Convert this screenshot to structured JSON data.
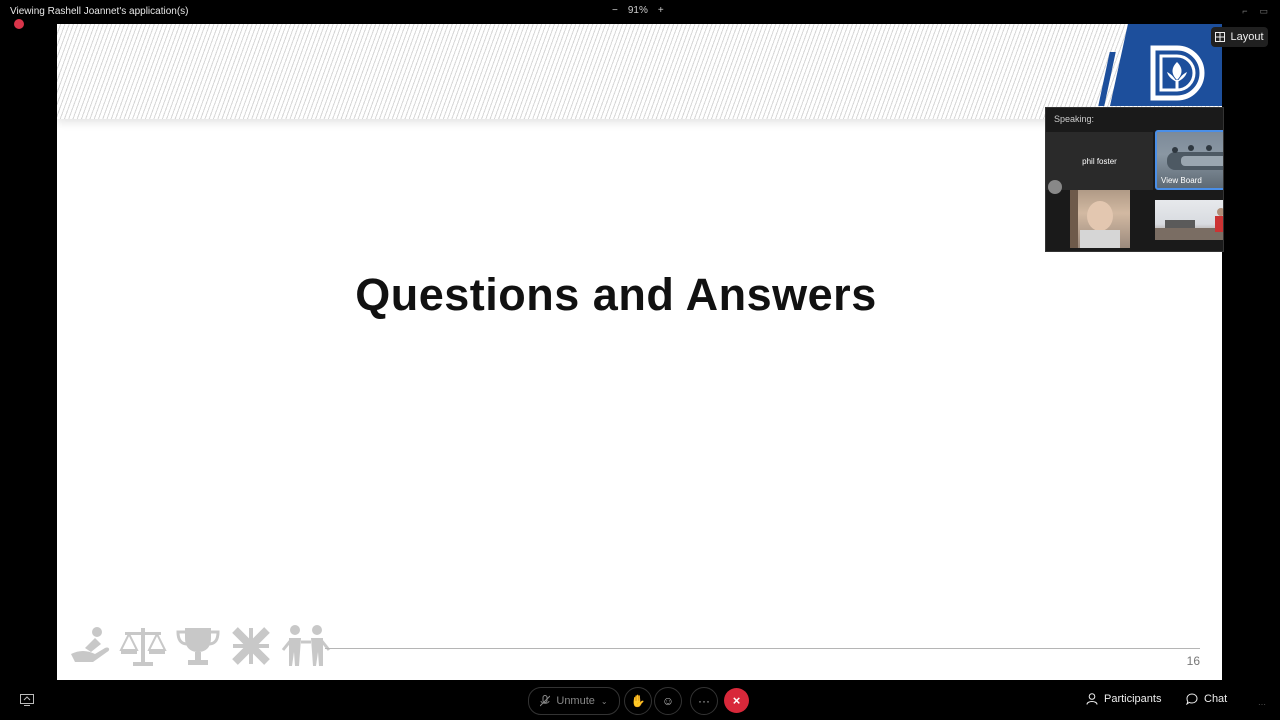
{
  "topbar": {
    "viewing_label": "Viewing Rashell Joannet's application(s)",
    "zoom_out": "−",
    "zoom_level": "91%",
    "zoom_in": "+"
  },
  "slide": {
    "title": "Questions and Answers",
    "page_number": "16"
  },
  "layout_button": {
    "label": "Layout"
  },
  "video_panel": {
    "speaking_label": "Speaking:",
    "tiles": [
      {
        "name": "phil foster"
      },
      {
        "name": "View Board"
      }
    ]
  },
  "controls": {
    "unmute_label": "Unmute",
    "more_label": "···",
    "end_label": "×",
    "participants_label": "Participants",
    "chat_label": "Chat"
  },
  "colors": {
    "brand_blue": "#1d4f9c",
    "end_call_red": "#d8283a",
    "active_tile_border": "#4a8fe8"
  }
}
